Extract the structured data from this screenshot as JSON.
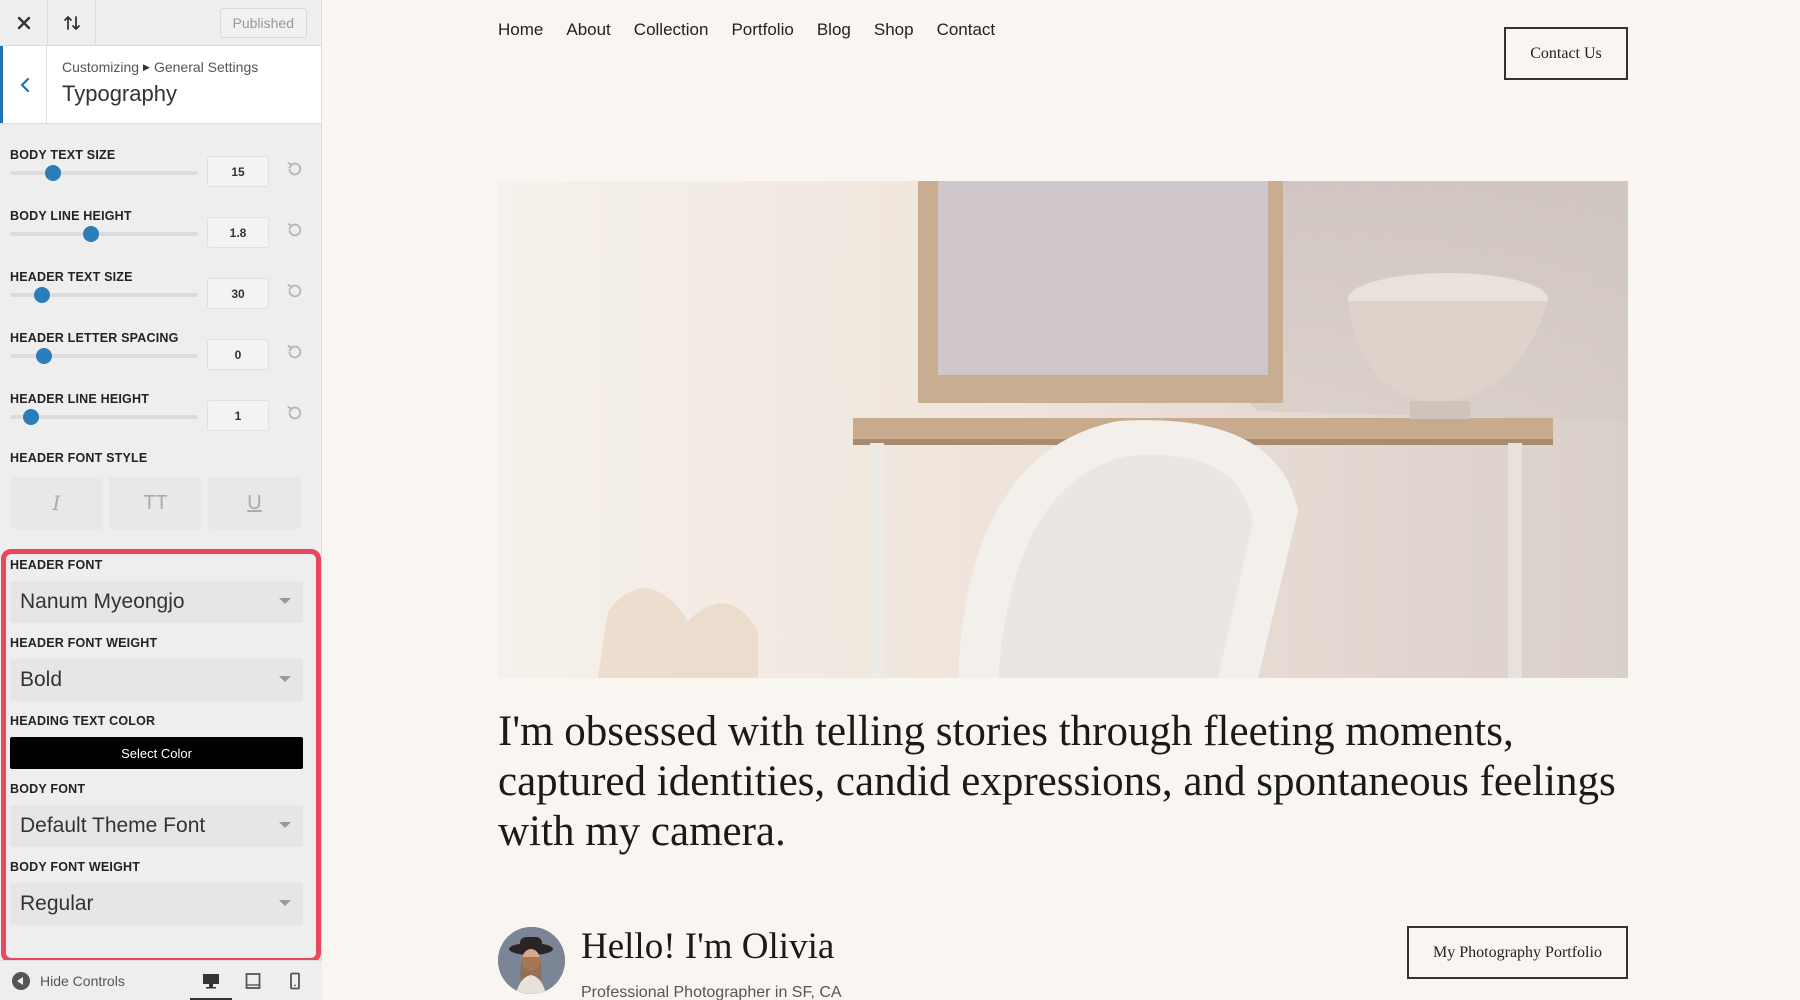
{
  "topbar": {
    "published_label": "Published"
  },
  "section": {
    "breadcrumb_root": "Customizing",
    "breadcrumb_parent": "General Settings",
    "title": "Typography"
  },
  "sliders": [
    {
      "label": "BODY TEXT SIZE",
      "value": "15",
      "level": 0.23
    },
    {
      "label": "BODY LINE HEIGHT",
      "value": "1.8",
      "level": 0.43
    },
    {
      "label": "HEADER TEXT SIZE",
      "value": "30",
      "level": 0.17
    },
    {
      "label": "HEADER LETTER SPACING",
      "value": "0",
      "level": 0.18
    },
    {
      "label": "HEADER LINE HEIGHT",
      "value": "1",
      "level": 0.11
    }
  ],
  "font_style": {
    "label": "HEADER FONT STYLE",
    "buttons": [
      "I",
      "TT",
      "U"
    ]
  },
  "fonts": {
    "header_font_label": "HEADER FONT",
    "header_font_value": "Nanum Myeongjo",
    "header_weight_label": "HEADER FONT WEIGHT",
    "header_weight_value": "Bold",
    "heading_color_label": "HEADING TEXT COLOR",
    "heading_color_button": "Select Color",
    "body_font_label": "BODY FONT",
    "body_font_value": "Default Theme Font",
    "body_weight_label": "BODY FONT WEIGHT",
    "body_weight_value": "Regular"
  },
  "footer": {
    "hide_controls": "Hide Controls"
  },
  "colors": {
    "accent": "#2a7db8",
    "highlight": "#e8475d",
    "heading_text": "#000000"
  },
  "nav": [
    "Home",
    "About",
    "Collection",
    "Portfolio",
    "Blog",
    "Shop",
    "Contact"
  ],
  "preview": {
    "contact_button": "Contact Us",
    "quote": "I'm obsessed with telling stories through fleeting moments, captured identities, candid expressions, and spontaneous feelings with my camera.",
    "hello": "Hello! I'm Olivia",
    "subtitle": "Professional Photographer in SF, CA",
    "portfolio_button": "My Photography Portfolio"
  }
}
